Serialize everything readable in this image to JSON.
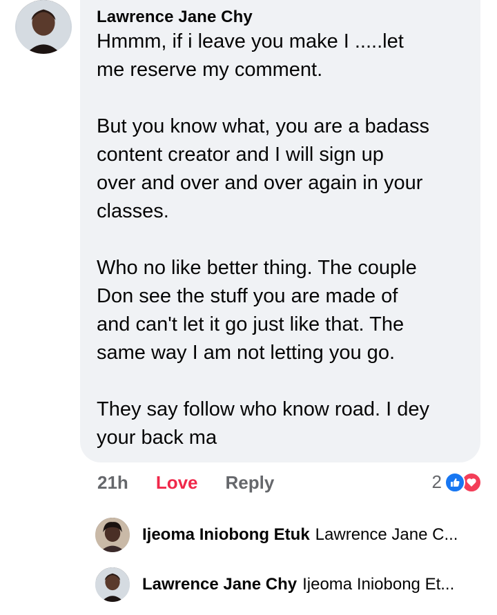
{
  "comment": {
    "author": "Lawrence Jane Chy",
    "paragraphs": [
      [
        "Hmmm, if i leave you make I .....let",
        "me reserve my comment."
      ],
      [
        "But you know what, you are a badass",
        "content creator and I will sign up",
        "over and over and over again in your",
        "classes."
      ],
      [
        "Who no like better thing. The couple",
        "Don see the stuff you are made of",
        "and can't let it go just like that. The",
        "same way I am not letting you go."
      ],
      [
        "They say follow who know road. I dey",
        "your back ma"
      ]
    ]
  },
  "actions": {
    "time": "21h",
    "love": "Love",
    "reply": "Reply"
  },
  "reactions": {
    "count": "2",
    "icons": [
      "like-icon",
      "love-icon"
    ],
    "like_color": "#1877f2",
    "love_color": "#f33e58"
  },
  "replies": [
    {
      "name": "Ijeoma Iniobong Etuk",
      "preview": "Lawrence Jane C..."
    },
    {
      "name": "Lawrence Jane Chy",
      "preview": "Ijeoma Iniobong Et..."
    }
  ]
}
